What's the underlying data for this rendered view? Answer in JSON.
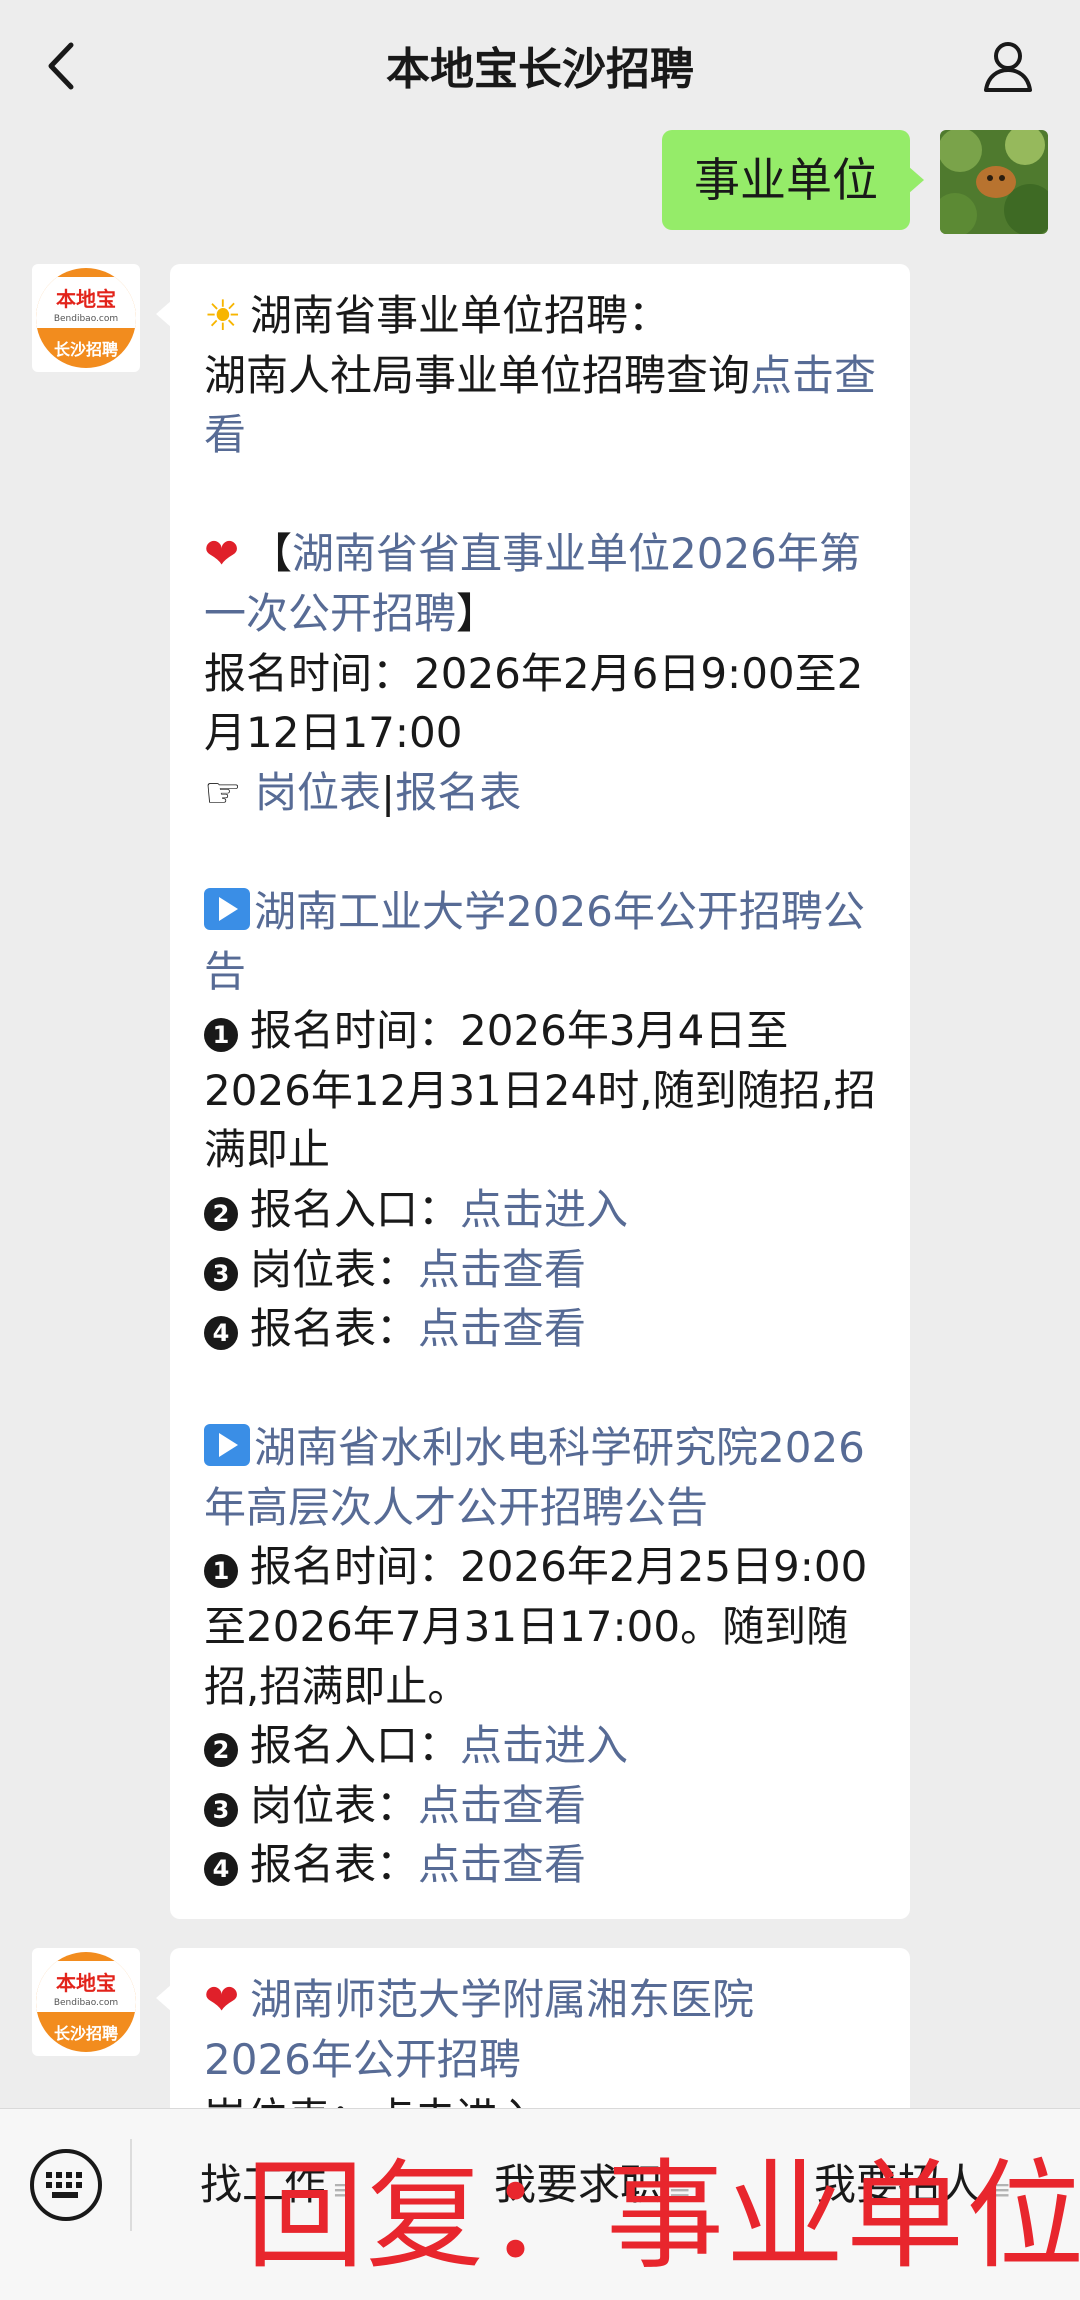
{
  "header": {
    "title": "本地宝长沙招聘"
  },
  "user_message": {
    "text": "事业单位"
  },
  "bot": {
    "logo_top": "本地宝",
    "logo_mid": "Bendibao.com",
    "logo_bottom": "长沙招聘"
  },
  "message1": {
    "sun_line": "湖南省事业单位招聘：",
    "line2_text": "湖南人社局事业单位招聘查询",
    "line2_link": "点击",
    "line3_link": "查看",
    "sec1_open": "【",
    "sec1_title": "湖南省省直事业单位2026年第一次公开招聘",
    "sec1_close": "】",
    "sec1_time": "报名时间：2026年2月6日9:00至2月12日17:00",
    "sec1_hand": "☞",
    "sec1_link1": "岗位表",
    "sec1_sep": "|",
    "sec1_link2": "报名表",
    "sec2_title": "湖南工业大学2026年公开招聘公告",
    "sec2_item1": "报名时间：2026年3月4日至2026年12月31日24时,随到随招,招满即止",
    "sec2_item2_label": "报名入口：",
    "sec2_item2_link": "点击进入",
    "sec2_item3_label": "岗位表：",
    "sec2_item3_link": "点击查看",
    "sec2_item4_label": "报名表：",
    "sec2_item4_link": "点击查看",
    "sec3_title": "湖南省水利水电科学研究院2026年高层次人才公开招聘公告",
    "sec3_item1": "报名时间：2026年2月25日9:00至2026年7月31日17:00。随到随招,招满即止。",
    "sec3_item2_label": "报名入口：",
    "sec3_item2_link": "点击进入",
    "sec3_item3_label": "岗位表：",
    "sec3_item3_link": "点击查看",
    "sec3_item4_label": "报名表：",
    "sec3_item4_link": "点击查看"
  },
  "message2": {
    "title_line1": "湖南师范大学附属湘东医院",
    "title_line2": "2026年公开招聘",
    "partial_line": "岗位表：点击进入"
  },
  "bottom_menu": {
    "item1": "找工作",
    "item2": "我要求职",
    "item3": "我要招人",
    "overlay": "回复：事业单位"
  },
  "numbers": {
    "n1": "1",
    "n2": "2",
    "n3": "3",
    "n4": "4"
  },
  "colors": {
    "link": "#576b95",
    "user_bubble": "#95ec69",
    "overlay": "#e8262d"
  }
}
